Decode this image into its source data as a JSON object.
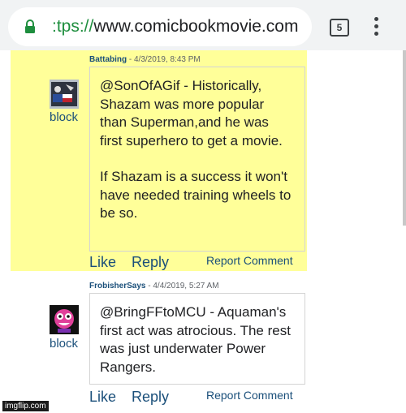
{
  "browser": {
    "url_scheme": ":tps://",
    "url_host": "www.comicbookmovie.com",
    "tab_count": "5"
  },
  "comments": [
    {
      "username": "Battabing",
      "meta": " - 4/3/2019, 8:43 PM",
      "avatar_label": "block",
      "paragraph1": "@SonOfAGif - Historically, Shazam was more popular than Superman,and he was first superhero to get a movie.",
      "paragraph2": "If Shazam is a success it won't have needed training wheels to be so.",
      "like": "Like",
      "reply": "Reply",
      "report": "Report Comment"
    },
    {
      "username": "FrobisherSays",
      "meta": " - 4/4/2019, 5:27 AM",
      "avatar_label": "block",
      "paragraph1": "@BringFFtoMCU - Aquaman's first act was atrocious. The rest was just underwater Power Rangers.",
      "like": "Like",
      "reply": "Reply",
      "report": "Report Comment"
    }
  ],
  "watermark": "imgflip.com",
  "colors": {
    "highlight": "#ffff99",
    "link": "#1a4f7a",
    "lock": "#1e8e3e"
  }
}
